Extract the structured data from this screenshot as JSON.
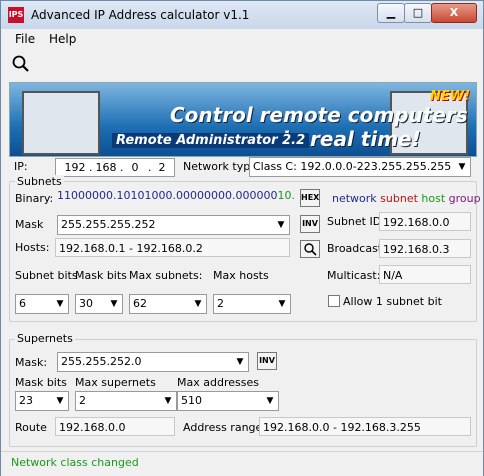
{
  "window": {
    "title": "Advanced IP Address calculator v1.1",
    "icon_text": "IPS",
    "min_btn": "▁",
    "max_btn": "□",
    "close_btn": "X"
  },
  "menu": {
    "file": "File",
    "help": "Help"
  },
  "banner": {
    "headline1": "Control remote computers",
    "headline2": "in real time!",
    "product": "Remote Administrator 2.2",
    "new_badge": "NEW!"
  },
  "ip": {
    "label": "IP:",
    "octets": [
      "192",
      "168",
      "0",
      "2"
    ]
  },
  "network_type": {
    "label": "Network type:",
    "value": "Class C: 192.0.0.0-223.255.255.255"
  },
  "subnets": {
    "group_label": "Subnets",
    "binary_label": "Binary:",
    "binary_network": "11000000.10101000.00000000.000000",
    "binary_host": "10.",
    "hex_button": "HEX",
    "legend": {
      "network": "network",
      "subnet": "subnet",
      "host": "host",
      "group": "group"
    },
    "mask_label": "Mask",
    "mask_value": "255.255.255.252",
    "inv_button": "INV",
    "subnet_id_label": "Subnet ID:",
    "subnet_id_value": "192.168.0.0",
    "hosts_label": "Hosts:",
    "hosts_value": "192.168.0.1 - 192.168.0.2",
    "broadcast_label": "Broadcast:",
    "broadcast_value": "192.168.0.3",
    "subnet_bits_label": "Subnet bits",
    "mask_bits_label": "Mask bits",
    "max_subnets_label": "Max subnets:",
    "max_hosts_label": "Max hosts",
    "multicast_label": "Multicast:",
    "multicast_value": "N/A",
    "subnet_bits_value": "6",
    "mask_bits_value": "30",
    "max_subnets_value": "62",
    "max_hosts_value": "2",
    "allow_label": "Allow 1 subnet bit"
  },
  "supernets": {
    "group_label": "Supernets",
    "mask_label": "Mask:",
    "mask_value": "255.255.252.0",
    "inv_button": "INV",
    "mask_bits_label": "Mask bits",
    "max_supernets_label": "Max supernets",
    "max_addresses_label": "Max addresses",
    "mask_bits_value": "23",
    "max_supernets_value": "2",
    "max_addresses_value": "510",
    "route_label": "Route",
    "route_value": "192.168.0.0",
    "address_range_label": "Address range:",
    "address_range_value": "192.168.0.0 - 192.168.3.255"
  },
  "status": {
    "text": "Network class changed"
  },
  "colors": {
    "network": "#1f2b8f",
    "subnet": "#b01818",
    "host": "#1a9a1a",
    "group": "#7a1a7a",
    "status": "#1a9a1a"
  }
}
